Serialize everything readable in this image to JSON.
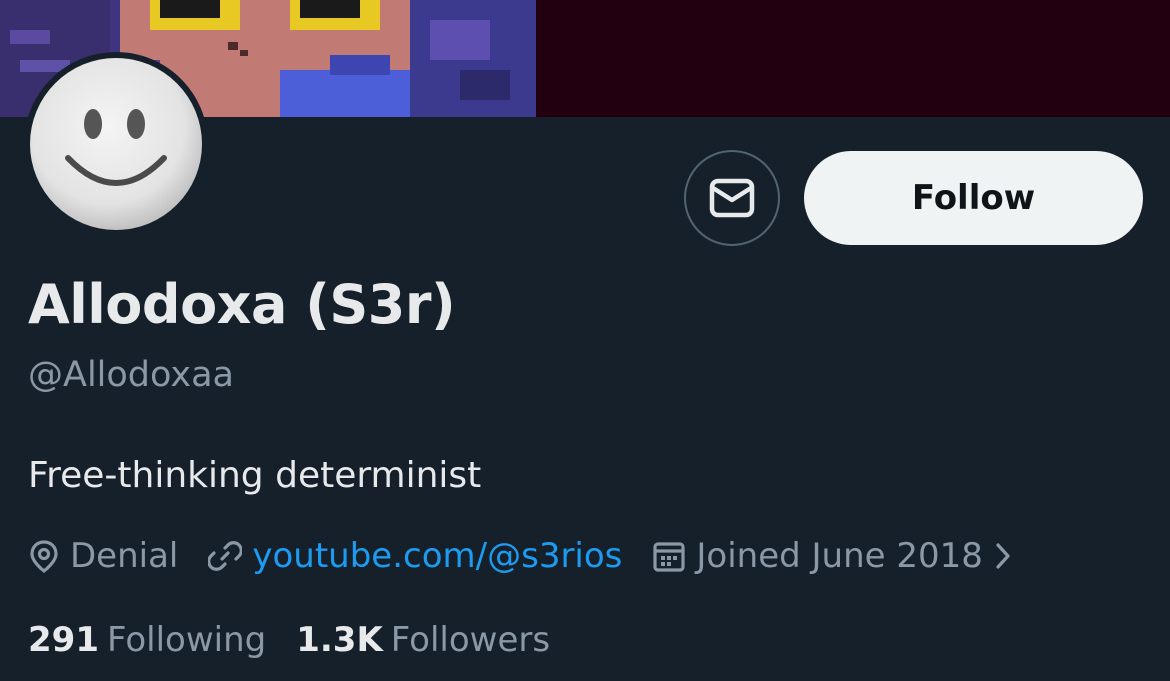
{
  "profile": {
    "display_name": "Allodoxa (S3r)",
    "handle": "@Allodoxaa",
    "bio": "Free-thinking determinist",
    "location": "Denial",
    "website": "youtube.com/@s3rios",
    "joined": "Joined June 2018"
  },
  "actions": {
    "follow_label": "Follow",
    "message_icon": "envelope-icon"
  },
  "stats": {
    "following_count": "291",
    "following_label": "Following",
    "followers_count": "1.3K",
    "followers_label": "Followers"
  },
  "icons": {
    "location": "location-pin-icon",
    "website": "link-icon",
    "joined": "calendar-icon",
    "more": "chevron-right-icon"
  },
  "colors": {
    "background": "#15202b",
    "text_primary": "#e7e9ea",
    "text_secondary": "#8b98a5",
    "link": "#1d9bf0",
    "follow_button_bg": "#eff3f4",
    "banner_dark": "#22000f"
  }
}
